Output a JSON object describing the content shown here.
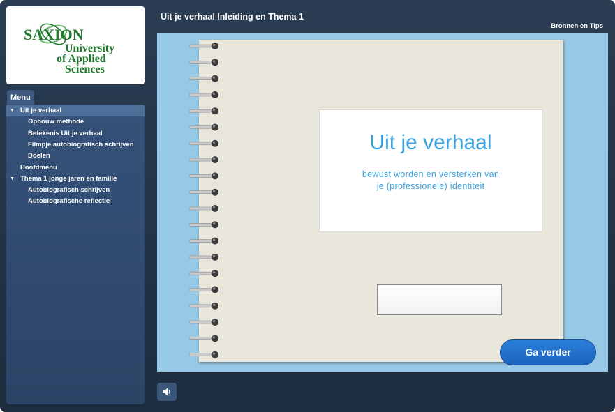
{
  "logo": {
    "brand": "SAXION",
    "line1": "University",
    "line2": "of Applied",
    "line3": "Sciences"
  },
  "menu": {
    "tab_label": "Menu",
    "items": [
      {
        "label": "Uit je verhaal",
        "level": 0,
        "expanded": true,
        "active": true
      },
      {
        "label": "Opbouw methode",
        "level": 1
      },
      {
        "label": "Betekenis Uit je verhaal",
        "level": 1
      },
      {
        "label": "Filmpje autobiografisch schrijven",
        "level": 1
      },
      {
        "label": "Doelen",
        "level": 1
      },
      {
        "label": "Hoofdmenu",
        "level": 0
      },
      {
        "label": "Thema 1 jonge jaren en familie",
        "level": 0,
        "expanded": true
      },
      {
        "label": "Autobiografisch schrijven",
        "level": 1
      },
      {
        "label": "Autobiografische reflectie",
        "level": 1
      }
    ]
  },
  "header": {
    "title": "Uit je verhaal Inleiding en Thema 1",
    "resources_label": "Bronnen en Tips"
  },
  "slide": {
    "card_title": "Uit je verhaal",
    "card_subtitle": "bewust worden en versterken van\nje (professionele) identiteit",
    "next_label": "Ga verder"
  },
  "icons": {
    "expand": "triangle-down-icon",
    "audio": "speaker-icon"
  },
  "colors": {
    "accent_blue": "#3aa1dd",
    "button_blue": "#1f6fcc",
    "stage_bg": "#96c9e6",
    "brand_green": "#1f7a2e"
  }
}
